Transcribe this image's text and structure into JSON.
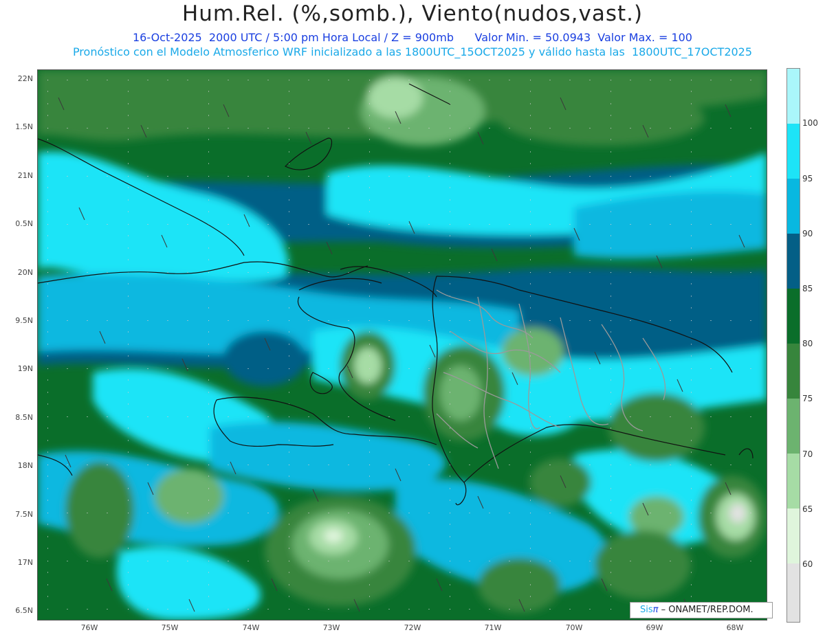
{
  "header": {
    "title": "Hum.Rel. (%,somb.), Viento(nudos,vast.)",
    "line1": "16-Oct-2025  2000 UTC / 5:00 pm Hora Local / Z = 900mb      Valor Min. = 50.0943  Valor Max. = 100",
    "line2": "Pronóstico con el Modelo Atmosferico WRF inicializado a las 1800UTC_15OCT2025 y válido hasta las  1800UTC_17OCT2025"
  },
  "axes": {
    "lat_labels": [
      "22N",
      "1.5N",
      "21N",
      "0.5N",
      "20N",
      "9.5N",
      "19N",
      "8.5N",
      "18N",
      "7.5N",
      "17N",
      "6.5N"
    ],
    "lon_labels": [
      "76W",
      "75W",
      "74W",
      "73W",
      "72W",
      "71W",
      "70W",
      "69W",
      "68W"
    ]
  },
  "colorbar": {
    "labels": [
      "100",
      "95",
      "90",
      "85",
      "80",
      "75",
      "70",
      "65",
      "60"
    ],
    "colors": [
      "#aaf6fa",
      "#1de4f7",
      "#08b8e0",
      "#045f86",
      "#0a6e2a",
      "#37853c",
      "#6cb36f",
      "#a6dca5",
      "#dff5dc",
      "#e2e2e2"
    ]
  },
  "credit": {
    "brand": "Sis",
    "pi": "π",
    "org": " – ONAMET/REP.DOM."
  }
}
